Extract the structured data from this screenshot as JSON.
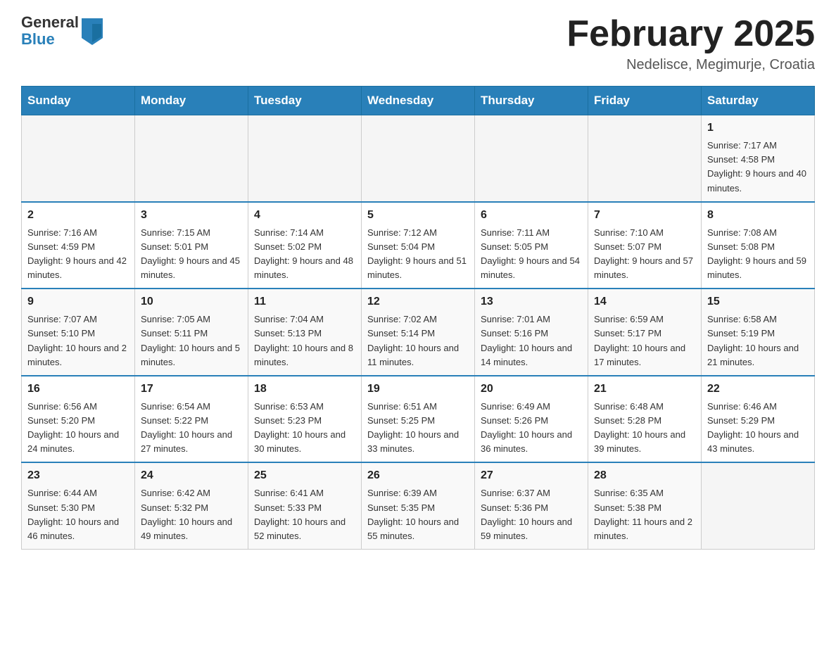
{
  "header": {
    "logo_general": "General",
    "logo_blue": "Blue",
    "month_title": "February 2025",
    "location": "Nedelisce, Megimurje, Croatia"
  },
  "days_of_week": [
    "Sunday",
    "Monday",
    "Tuesday",
    "Wednesday",
    "Thursday",
    "Friday",
    "Saturday"
  ],
  "weeks": [
    [
      {
        "day": "",
        "info": ""
      },
      {
        "day": "",
        "info": ""
      },
      {
        "day": "",
        "info": ""
      },
      {
        "day": "",
        "info": ""
      },
      {
        "day": "",
        "info": ""
      },
      {
        "day": "",
        "info": ""
      },
      {
        "day": "1",
        "info": "Sunrise: 7:17 AM\nSunset: 4:58 PM\nDaylight: 9 hours and 40 minutes."
      }
    ],
    [
      {
        "day": "2",
        "info": "Sunrise: 7:16 AM\nSunset: 4:59 PM\nDaylight: 9 hours and 42 minutes."
      },
      {
        "day": "3",
        "info": "Sunrise: 7:15 AM\nSunset: 5:01 PM\nDaylight: 9 hours and 45 minutes."
      },
      {
        "day": "4",
        "info": "Sunrise: 7:14 AM\nSunset: 5:02 PM\nDaylight: 9 hours and 48 minutes."
      },
      {
        "day": "5",
        "info": "Sunrise: 7:12 AM\nSunset: 5:04 PM\nDaylight: 9 hours and 51 minutes."
      },
      {
        "day": "6",
        "info": "Sunrise: 7:11 AM\nSunset: 5:05 PM\nDaylight: 9 hours and 54 minutes."
      },
      {
        "day": "7",
        "info": "Sunrise: 7:10 AM\nSunset: 5:07 PM\nDaylight: 9 hours and 57 minutes."
      },
      {
        "day": "8",
        "info": "Sunrise: 7:08 AM\nSunset: 5:08 PM\nDaylight: 9 hours and 59 minutes."
      }
    ],
    [
      {
        "day": "9",
        "info": "Sunrise: 7:07 AM\nSunset: 5:10 PM\nDaylight: 10 hours and 2 minutes."
      },
      {
        "day": "10",
        "info": "Sunrise: 7:05 AM\nSunset: 5:11 PM\nDaylight: 10 hours and 5 minutes."
      },
      {
        "day": "11",
        "info": "Sunrise: 7:04 AM\nSunset: 5:13 PM\nDaylight: 10 hours and 8 minutes."
      },
      {
        "day": "12",
        "info": "Sunrise: 7:02 AM\nSunset: 5:14 PM\nDaylight: 10 hours and 11 minutes."
      },
      {
        "day": "13",
        "info": "Sunrise: 7:01 AM\nSunset: 5:16 PM\nDaylight: 10 hours and 14 minutes."
      },
      {
        "day": "14",
        "info": "Sunrise: 6:59 AM\nSunset: 5:17 PM\nDaylight: 10 hours and 17 minutes."
      },
      {
        "day": "15",
        "info": "Sunrise: 6:58 AM\nSunset: 5:19 PM\nDaylight: 10 hours and 21 minutes."
      }
    ],
    [
      {
        "day": "16",
        "info": "Sunrise: 6:56 AM\nSunset: 5:20 PM\nDaylight: 10 hours and 24 minutes."
      },
      {
        "day": "17",
        "info": "Sunrise: 6:54 AM\nSunset: 5:22 PM\nDaylight: 10 hours and 27 minutes."
      },
      {
        "day": "18",
        "info": "Sunrise: 6:53 AM\nSunset: 5:23 PM\nDaylight: 10 hours and 30 minutes."
      },
      {
        "day": "19",
        "info": "Sunrise: 6:51 AM\nSunset: 5:25 PM\nDaylight: 10 hours and 33 minutes."
      },
      {
        "day": "20",
        "info": "Sunrise: 6:49 AM\nSunset: 5:26 PM\nDaylight: 10 hours and 36 minutes."
      },
      {
        "day": "21",
        "info": "Sunrise: 6:48 AM\nSunset: 5:28 PM\nDaylight: 10 hours and 39 minutes."
      },
      {
        "day": "22",
        "info": "Sunrise: 6:46 AM\nSunset: 5:29 PM\nDaylight: 10 hours and 43 minutes."
      }
    ],
    [
      {
        "day": "23",
        "info": "Sunrise: 6:44 AM\nSunset: 5:30 PM\nDaylight: 10 hours and 46 minutes."
      },
      {
        "day": "24",
        "info": "Sunrise: 6:42 AM\nSunset: 5:32 PM\nDaylight: 10 hours and 49 minutes."
      },
      {
        "day": "25",
        "info": "Sunrise: 6:41 AM\nSunset: 5:33 PM\nDaylight: 10 hours and 52 minutes."
      },
      {
        "day": "26",
        "info": "Sunrise: 6:39 AM\nSunset: 5:35 PM\nDaylight: 10 hours and 55 minutes."
      },
      {
        "day": "27",
        "info": "Sunrise: 6:37 AM\nSunset: 5:36 PM\nDaylight: 10 hours and 59 minutes."
      },
      {
        "day": "28",
        "info": "Sunrise: 6:35 AM\nSunset: 5:38 PM\nDaylight: 11 hours and 2 minutes."
      },
      {
        "day": "",
        "info": ""
      }
    ]
  ]
}
